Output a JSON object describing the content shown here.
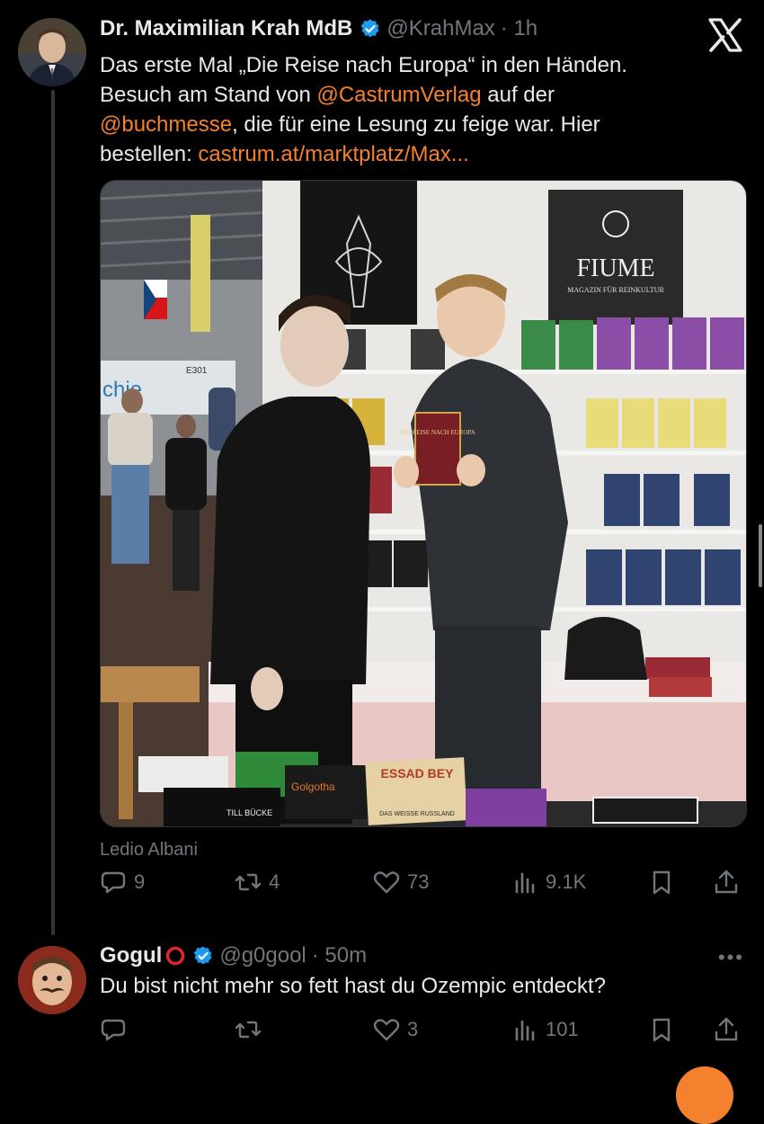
{
  "post": {
    "author_name": "Dr. Maximilian Krah MdB",
    "handle": "@KrahMax",
    "time": "· 1h",
    "text_line1": "Das erste Mal „Die Reise nach Europa“ in den Händen.",
    "text_line2a": "Besuch am Stand von ",
    "text_mention1": "@CastrumVerlag",
    "text_line2b": " auf der",
    "text_mention2": "@buchmesse",
    "text_line3": ", die für eine Lesung zu feige war. Hier",
    "text_line4": "bestellen: ",
    "text_link": "castrum.at/marktplatz/Max...",
    "photo_credit": "Ledio Albani",
    "photo_signs": {
      "fiume_title": "FIUME",
      "fiume_sub": "MAGAZIN FÜR REINKULTUR",
      "booth": "E301",
      "hall_fragment": "chie",
      "book_title": "DIE REISE NACH EUROPA",
      "table_book1": "ESSAD BEY",
      "table_book1_sub": "DAS WEISSE RUSSLAND",
      "table_book2": "Golgotha",
      "table_book3": "TILL BÜCKE"
    },
    "stats": {
      "replies": "9",
      "reposts": "4",
      "likes": "73",
      "views": "9.1K"
    }
  },
  "reply": {
    "author_name": "Gogul",
    "handle": "@g0gool",
    "time": "· 50m",
    "text": "Du bist nicht mehr so fett hast du Ozempic entdeckt?",
    "stats": {
      "likes": "3",
      "views": "101"
    }
  },
  "icons": {
    "verified": "verified-badge-icon",
    "x_logo": "x-logo-icon",
    "reply": "reply-icon",
    "repost": "repost-icon",
    "like": "like-icon",
    "views": "views-icon",
    "bookmark": "bookmark-icon",
    "share": "share-icon",
    "more": "more-icon"
  },
  "colors": {
    "background": "#000000",
    "text": "#e7e9ea",
    "muted": "#71767b",
    "link": "#f4812d",
    "verified": "#1d9bf0"
  }
}
